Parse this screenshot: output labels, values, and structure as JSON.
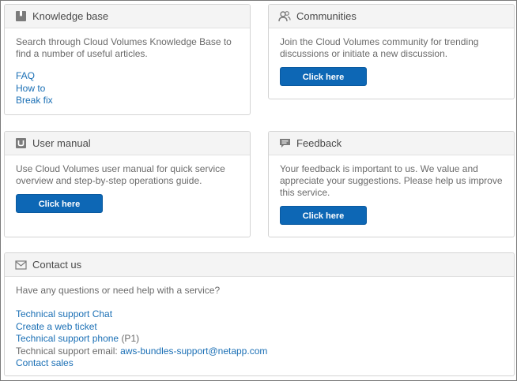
{
  "knowledge_base": {
    "title": "Knowledge base",
    "icon": "book-icon",
    "description": "Search through Cloud Volumes Knowledge Base to find a number of useful articles.",
    "links": [
      "FAQ",
      "How to",
      "Break fix"
    ]
  },
  "communities": {
    "title": "Communities",
    "icon": "people-icon",
    "description": "Join the Cloud Volumes community for trending discussions or initiate a new discussion.",
    "button_label": "Click here"
  },
  "user_manual": {
    "title": "User manual",
    "icon": "manual-icon",
    "description": "Use Cloud Volumes user manual for quick service overview and step-by-step operations guide.",
    "button_label": "Click here"
  },
  "feedback": {
    "title": "Feedback",
    "icon": "chat-bubble-icon",
    "description": "Your feedback is important to us. We value and appreciate your suggestions. Please help us improve this service.",
    "button_label": "Click here"
  },
  "contact": {
    "title": "Contact us",
    "icon": "envelope-icon",
    "question": "Have any questions or need help with a service?",
    "chat_link": "Technical support Chat",
    "ticket_link": "Create a web ticket",
    "phone_link": "Technical support phone",
    "phone_priority": "(P1)",
    "email_label": "Technical support email:",
    "email_link": "aws-bundles-support@netapp.com",
    "sales_link": "Contact sales"
  },
  "colors": {
    "accent": "#0d67b5",
    "link": "#1a6fb5",
    "header_bg": "#f4f4f4"
  }
}
